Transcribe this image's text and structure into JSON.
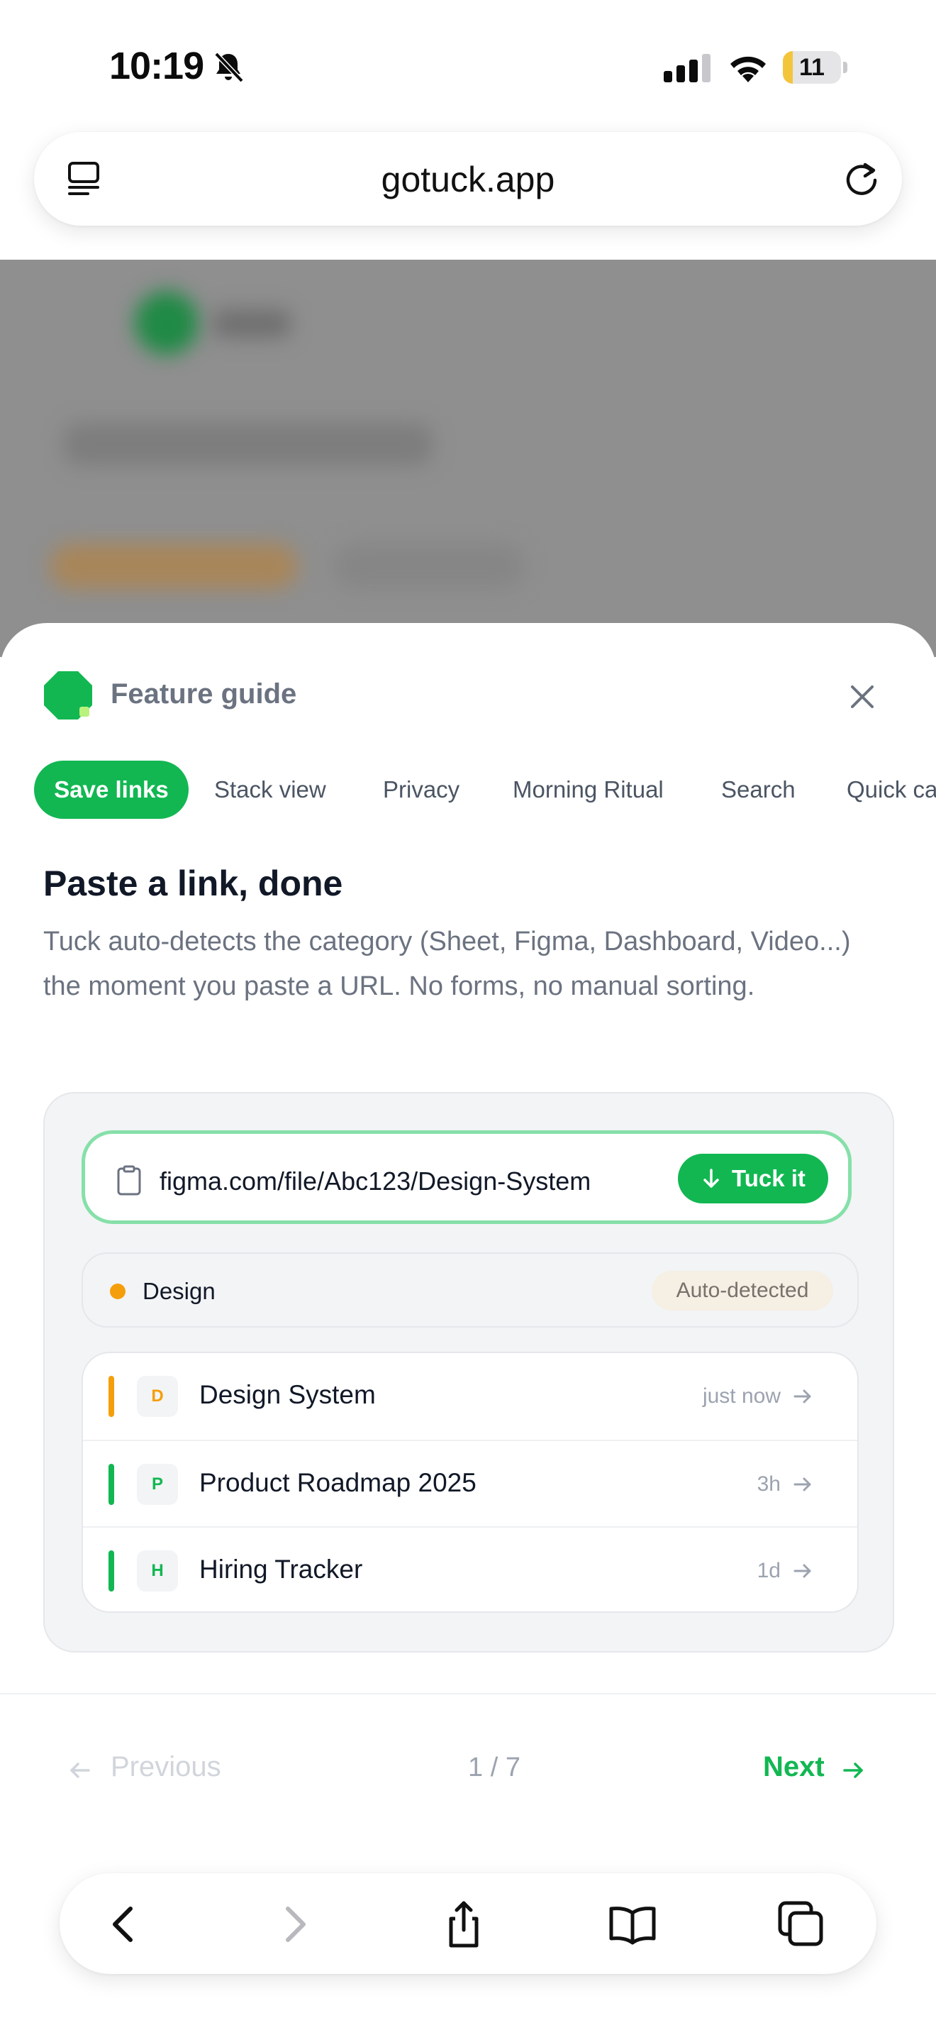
{
  "status_bar": {
    "time": "10:19",
    "battery": "11",
    "battery_level_percent": 11
  },
  "browser": {
    "url": "gotuck.app"
  },
  "sheet": {
    "title": "Feature guide",
    "tabs": [
      {
        "label": "Save links",
        "active": true
      },
      {
        "label": "Stack view",
        "active": false
      },
      {
        "label": "Privacy",
        "active": false
      },
      {
        "label": "Morning Ritual",
        "active": false
      },
      {
        "label": "Search",
        "active": false
      },
      {
        "label": "Quick ca",
        "active": false
      }
    ],
    "heading": "Paste a link, done",
    "description": "Tuck auto-detects the category (Sheet, Figma, Dashboard, Video...) the moment you paste a URL. No forms, no manual sorting.",
    "demo": {
      "pasted_url": "figma.com/file/Abc123/Design-System",
      "tuck_button": "Tuck it",
      "category": "Design",
      "category_color": "#f59e0b",
      "detected_badge": "Auto-detected",
      "items": [
        {
          "initial": "D",
          "title": "Design System",
          "time": "just now",
          "color": "#f59e0b"
        },
        {
          "initial": "P",
          "title": "Product Roadmap 2025",
          "time": "3h",
          "color": "#12b752"
        },
        {
          "initial": "H",
          "title": "Hiring Tracker",
          "time": "1d",
          "color": "#12b752"
        }
      ]
    },
    "pagination": {
      "previous": "Previous",
      "page": "1 / 7",
      "next": "Next"
    }
  },
  "colors": {
    "accent": "#12b752",
    "accent_light": "#86e0a9"
  },
  "toolbar_icons": [
    "back-icon",
    "forward-icon",
    "share-icon",
    "bookmarks-icon",
    "tabs-icon"
  ]
}
